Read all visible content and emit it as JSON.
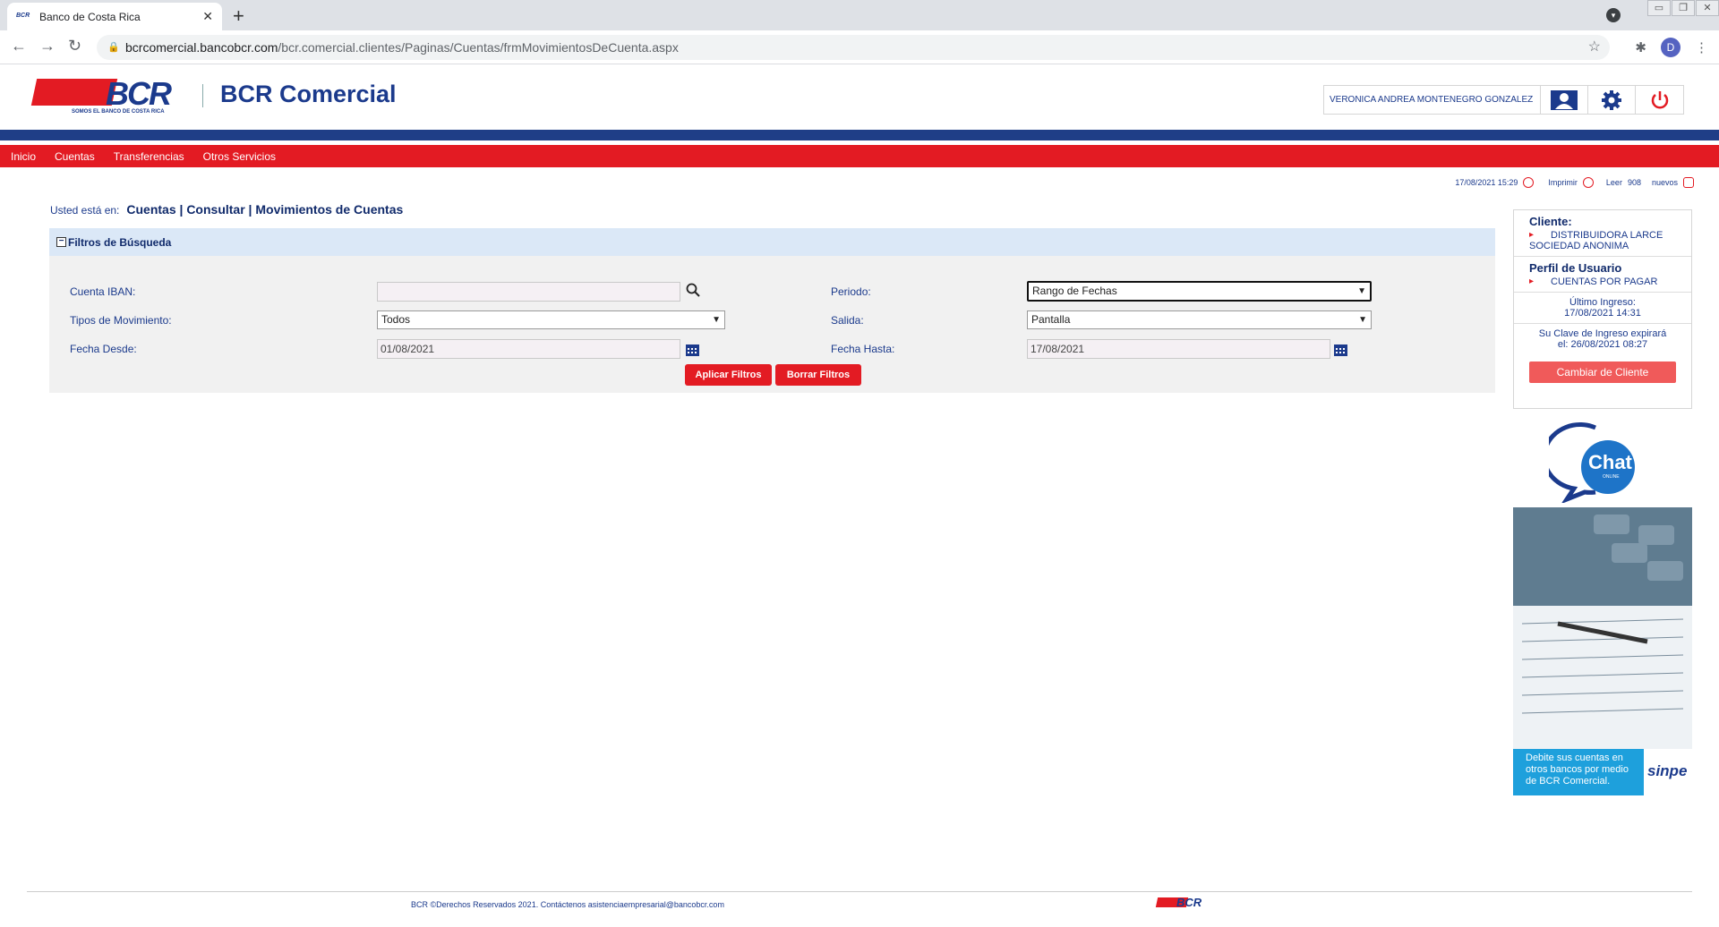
{
  "browser": {
    "tab_title": "Banco de Costa Rica",
    "favicon": "BCR",
    "url_host": "bcrcomercial.bancobcr.com",
    "url_path": "/bcr.comercial.clientes/Paginas/Cuentas/frmMovimientosDeCuenta.aspx",
    "profile_initial": "D"
  },
  "header": {
    "logo_text": "BCR",
    "logo_tag": "SOMOS EL BANCO DE COSTA RICA",
    "app_title": "BCR Comercial",
    "user_name": "VERONICA ANDREA MONTENEGRO GONZALEZ"
  },
  "menu": [
    "Inicio",
    "Cuentas",
    "Transferencias",
    "Otros Servicios"
  ],
  "info": {
    "datetime": "17/08/2021 15:29",
    "print": "Imprimir",
    "read": "Leer",
    "count": "908",
    "new": "nuevos"
  },
  "breadcrumb": {
    "prefix": "Usted está en:",
    "path": "Cuentas | Consultar | Movimientos de Cuentas"
  },
  "filters": {
    "title": "Filtros de Búsqueda",
    "iban_label": "Cuenta IBAN:",
    "iban_value": "",
    "tipos_label": "Tipos de Movimiento:",
    "tipos_value": "Todos",
    "desde_label": "Fecha Desde:",
    "desde_value": "01/08/2021",
    "periodo_label": "Periodo:",
    "periodo_value": "Rango de Fechas",
    "salida_label": "Salida:",
    "salida_value": "Pantalla",
    "hasta_label": "Fecha Hasta:",
    "hasta_value": "17/08/2021",
    "apply": "Aplicar Filtros",
    "clear": "Borrar Filtros"
  },
  "sidebar": {
    "client_h": "Cliente:",
    "client_l1": "DISTRIBUIDORA LARCE",
    "client_l2": "SOCIEDAD ANONIMA",
    "profile_h": "Perfil de Usuario",
    "profile_v": "CUENTAS POR PAGAR",
    "last_login_l": "Último Ingreso:",
    "last_login_v": "17/08/2021 14:31",
    "expire_l": "Su Clave de Ingreso expirará",
    "expire_v": "el: 26/08/2021 08:27",
    "change_client": "Cambiar de Cliente"
  },
  "chat": {
    "label": "Chat",
    "sub": "ONLINE"
  },
  "promo": {
    "text1": "Debite sus cuentas en",
    "text2": "otros bancos por medio",
    "text3": "de BCR Comercial.",
    "brand": "sinpe"
  },
  "footer": {
    "text": "BCR ©Derechos Reservados 2021. Contáctenos asistenciaempresarial@bancobcr.com"
  },
  "colors": {
    "brand_red": "#e31b23",
    "brand_blue": "#1b3a8c"
  }
}
